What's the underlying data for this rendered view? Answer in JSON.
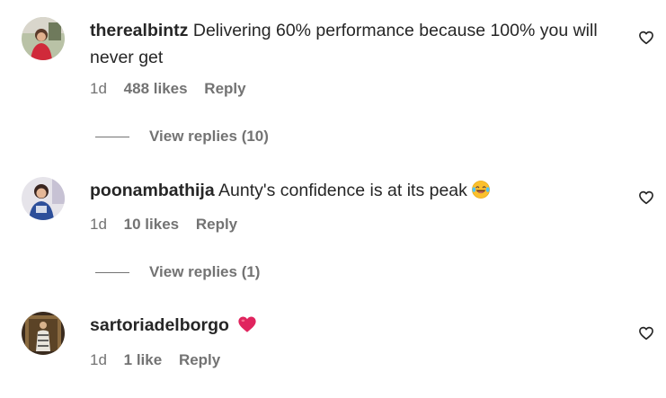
{
  "comments": [
    {
      "username": "therealbintz",
      "text": "Delivering 60% performance because 100% you will never get",
      "time": "1d",
      "likes": "488 likes",
      "reply_label": "Reply",
      "view_replies": "View replies (10)",
      "avatar_icon": "user-avatar-red-dress"
    },
    {
      "username": "poonambathija",
      "text": "Aunty's confidence is at its peak",
      "time": "1d",
      "likes": "10 likes",
      "reply_label": "Reply",
      "view_replies": "View replies (1)",
      "avatar_icon": "user-avatar-blue-outfit",
      "emoji_icon": "laughing-tears-emoji"
    },
    {
      "username": "sartoriadelborgo",
      "text": "",
      "time": "1d",
      "likes": "1 like",
      "reply_label": "Reply",
      "avatar_icon": "user-avatar-storefront",
      "emoji_icon": "red-heart-emoji"
    }
  ],
  "colors": {
    "text": "#262626",
    "secondary": "#737373",
    "heart_emoji": "#e0245e"
  }
}
